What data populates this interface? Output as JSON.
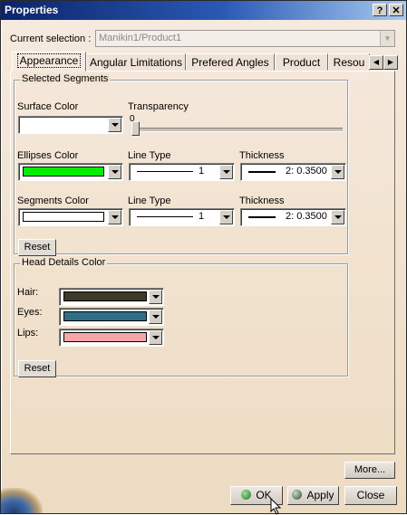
{
  "window": {
    "title": "Properties",
    "help_label": "?",
    "close_label": "✕"
  },
  "selection": {
    "label": "Current selection :",
    "value": "Manikin1/Product1"
  },
  "tabs": [
    {
      "label": "Appearance"
    },
    {
      "label": "Angular Limitations"
    },
    {
      "label": "Prefered Angles"
    },
    {
      "label": "Product"
    },
    {
      "label": "Resou"
    }
  ],
  "selected_segments": {
    "title": "Selected Segments",
    "surface_color_label": "Surface Color",
    "transparency_label": "Transparency",
    "transparency_value": "0",
    "ellipses_color_label": "Ellipses Color",
    "ellipses_color": "#00ee00",
    "ellipses_line_type_label": "Line Type",
    "ellipses_line_type_value": "1",
    "ellipses_thickness_label": "Thickness",
    "ellipses_thickness_value": "2: 0.3500",
    "segments_color_label": "Segments Color",
    "segments_color": "#ffffff",
    "segments_line_type_label": "Line Type",
    "segments_line_type_value": "1",
    "segments_thickness_label": "Thickness",
    "segments_thickness_value": "2: 0.3500",
    "reset_label": "Reset"
  },
  "head_details": {
    "title": "Head Details Color",
    "hair_label": "Hair:",
    "hair_color": "#3d3a2c",
    "eyes_label": "Eyes:",
    "eyes_color": "#2e6e86",
    "lips_label": "Lips:",
    "lips_color": "#f6a6a8",
    "reset_label": "Reset"
  },
  "buttons": {
    "more": "More...",
    "ok": "OK",
    "apply": "Apply",
    "close": "Close"
  }
}
